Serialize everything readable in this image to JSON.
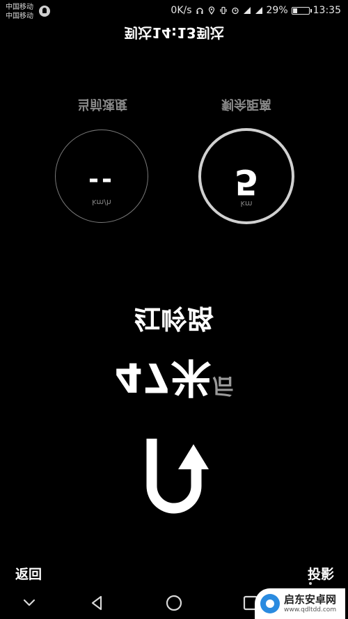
{
  "status_bar": {
    "carrier_1": "中国移动",
    "carrier_2": "中国移动",
    "net_speed": "0K/s",
    "sim1_net": "4G",
    "sim2_net": "2G",
    "battery_text": "29%",
    "battery_level": 0.29,
    "clock": "13:35"
  },
  "hud": {
    "eta": "到达14:13到达",
    "speed": {
      "label": "当前速度",
      "unit": "km/h",
      "value": "--"
    },
    "remaining": {
      "label": "剩余距离",
      "unit": "km",
      "value": "5"
    },
    "road_name": "红岭路",
    "distance": "47米",
    "distance_suffix": "后"
  },
  "actions": {
    "back_label": "返回",
    "cast_label": "投影"
  },
  "watermark": {
    "name": "启东安卓网",
    "url": "www.qdltdd.com"
  }
}
